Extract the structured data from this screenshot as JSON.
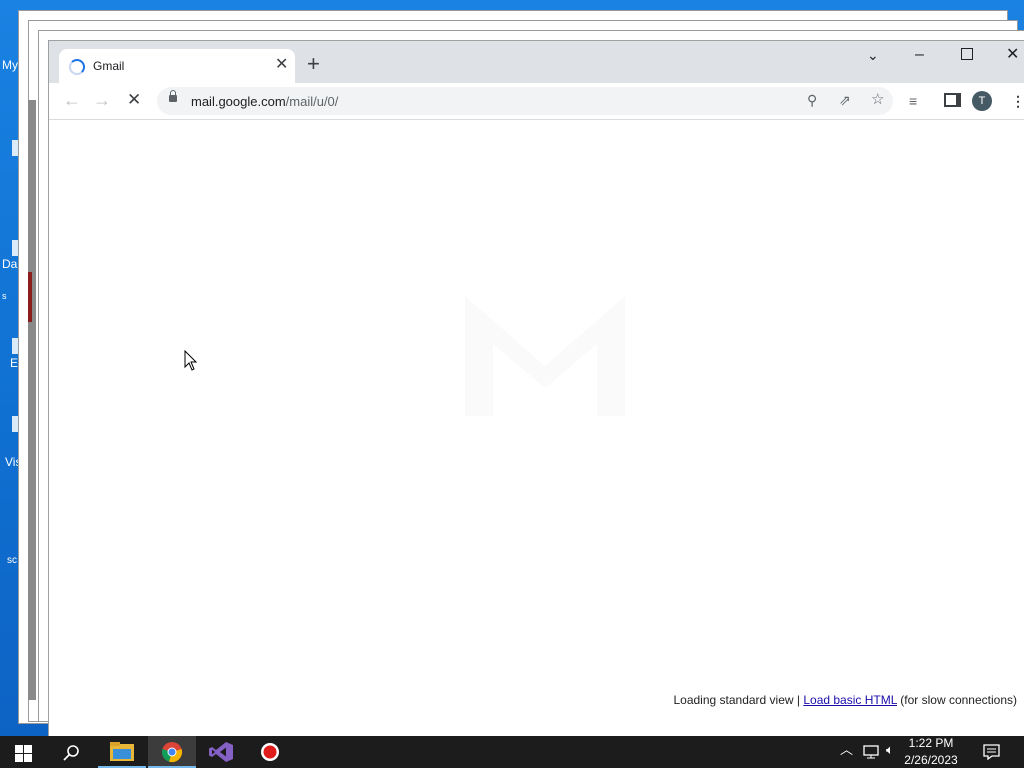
{
  "desktop": {
    "labels": [
      "My",
      "Da",
      "E",
      "Vis",
      "sc",
      "s"
    ]
  },
  "browser": {
    "tab": {
      "title": "Gmail"
    },
    "address": {
      "host": "mail.google.com",
      "path": "/mail/u/0/"
    },
    "profile_initial": "T"
  },
  "page": {
    "loading_text": "Loading standard view | ",
    "basic_link": "Load basic HTML",
    "slow_text": " (for slow connections)"
  },
  "taskbar": {
    "time": "1:22 PM",
    "date": "2/26/2023"
  }
}
